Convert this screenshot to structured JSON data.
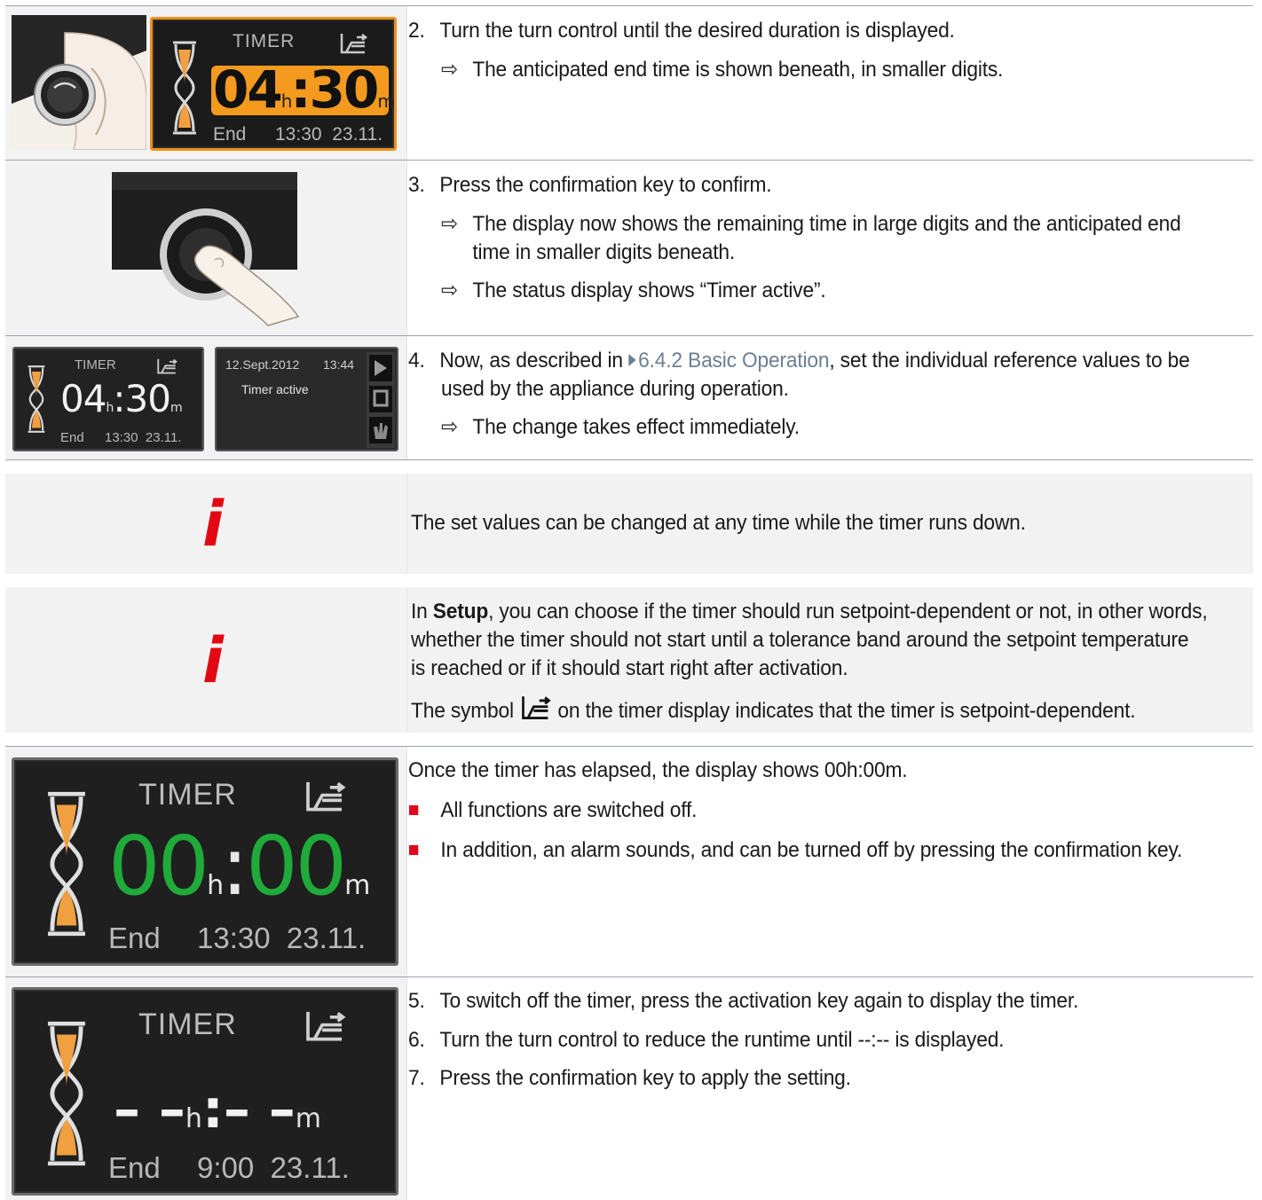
{
  "row1": {
    "display": {
      "title": "TIMER",
      "hours": "04",
      "h_unit": "h",
      "sep": ":",
      "minutes": "30",
      "m_unit": "m",
      "end_label": "End",
      "end_value": "13:30  23.11."
    },
    "step_num": "2.",
    "step_text": "Turn the turn control until the desired duration is displayed.",
    "result_arrow": "⇨",
    "results": [
      "The anticipated end time is shown beneath, in smaller digits."
    ]
  },
  "row2": {
    "step_num": "3.",
    "step_text": "Press the confirmation key to confirm.",
    "result_arrow": "⇨",
    "results": [
      "The display now shows the remaining time in large digits and the anticipated end",
      "time in smaller digits beneath.",
      "The status display shows “Timer active”."
    ]
  },
  "row3": {
    "display": {
      "title": "TIMER",
      "hours": "04",
      "h_unit": "h",
      "sep": ":",
      "minutes": "30",
      "m_unit": "m",
      "end_label": "End",
      "end_value": "13:30  23.11."
    },
    "status": {
      "date": "12.Sept.2012",
      "time": "13:44",
      "status_text": "Timer active"
    },
    "step_num": "4.",
    "step_text_a": "Now, as described in ",
    "link_text": "6.4.2 Basic Operation",
    "step_text_b": ", set the individual reference values to be",
    "step_text_c": "used by the appliance during operation.",
    "result_arrow": "⇨",
    "results": [
      "The change takes effect immediately."
    ]
  },
  "note1": {
    "icon_letter": "i",
    "text": "The set values can be changed at any time while the timer runs down."
  },
  "note2": {
    "icon_letter": "i",
    "line1_a": "In ",
    "line1_bold": "Setup",
    "line1_b": ", you can choose if the timer should run setpoint-dependent or not, in other words,",
    "line2": "whether the timer should not start until a tolerance band around the setpoint temperature",
    "line3": "is reached or if it should start right after activation.",
    "line4_a": "The symbol",
    "line4_b": "on the timer display indicates that the timer is setpoint-dependent."
  },
  "row4": {
    "display": {
      "title": "TIMER",
      "hours": "00",
      "h_unit": "h",
      "sep": ":",
      "minutes": "00",
      "m_unit": "m",
      "end_label": "End",
      "end_value": "13:30  23.11."
    },
    "intro": "Once the timer has elapsed, the display shows 00h:00m.",
    "bullets": [
      "All functions are switched off.",
      "In addition, an alarm sounds, and can be turned off by pressing the confirmation key."
    ]
  },
  "row5": {
    "display": {
      "title": "TIMER",
      "hours": "– –",
      "h_unit": "h",
      "sep": ":",
      "minutes": "– –",
      "m_unit": "m",
      "end_label": "End",
      "end_value": "9:00  23.11."
    },
    "steps": [
      {
        "num": "5.",
        "text": "To switch off the timer, press the activation key again to display the timer."
      },
      {
        "num": "6.",
        "text": "Turn the turn control to reduce the runtime until --:-- is displayed."
      },
      {
        "num": "7.",
        "text": "Press the confirmation key to apply the setting."
      }
    ]
  }
}
